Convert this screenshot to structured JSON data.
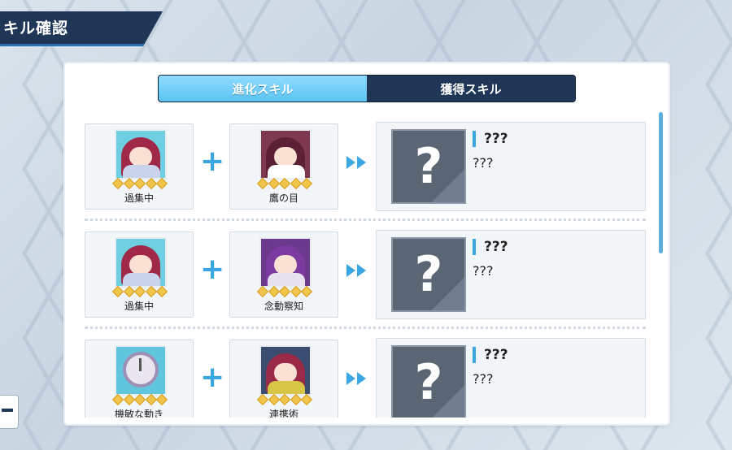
{
  "header": {
    "title": "キル確認"
  },
  "tabs": [
    {
      "label": "進化スキル",
      "active": true
    },
    {
      "label": "獲得スキル",
      "active": false
    }
  ],
  "rows": [
    {
      "skill_a": {
        "name": "過集中",
        "stars": 5,
        "art": "girl-hands-bg-teal"
      },
      "skill_b": {
        "name": "鷹の目",
        "stars": 5,
        "art": "girl-owl-hood"
      },
      "result": {
        "title": "???",
        "desc": "???",
        "icon": "question-icon"
      }
    },
    {
      "skill_a": {
        "name": "過集中",
        "stars": 5,
        "art": "girl-hands-bg-teal"
      },
      "skill_b": {
        "name": "念動察知",
        "stars": 5,
        "art": "girl-purple-hair"
      },
      "result": {
        "title": "???",
        "desc": "???",
        "icon": "question-icon"
      }
    },
    {
      "skill_a": {
        "name": "機敏な動き",
        "stars": 5,
        "art": "pocket-watch"
      },
      "skill_b": {
        "name": "連携術",
        "stars": 5,
        "art": "girl-weapon"
      },
      "result": {
        "title": "???",
        "desc": "???",
        "icon": "question-icon"
      }
    }
  ],
  "colors": {
    "accent": "#3aa7e4",
    "header_bg": "#1f3656",
    "tab_active": "#5cc3f2",
    "star": "#f1c44c"
  },
  "icons": {
    "plus": "plus-icon",
    "arrow": "fast-forward-icon",
    "back": "back-icon"
  }
}
